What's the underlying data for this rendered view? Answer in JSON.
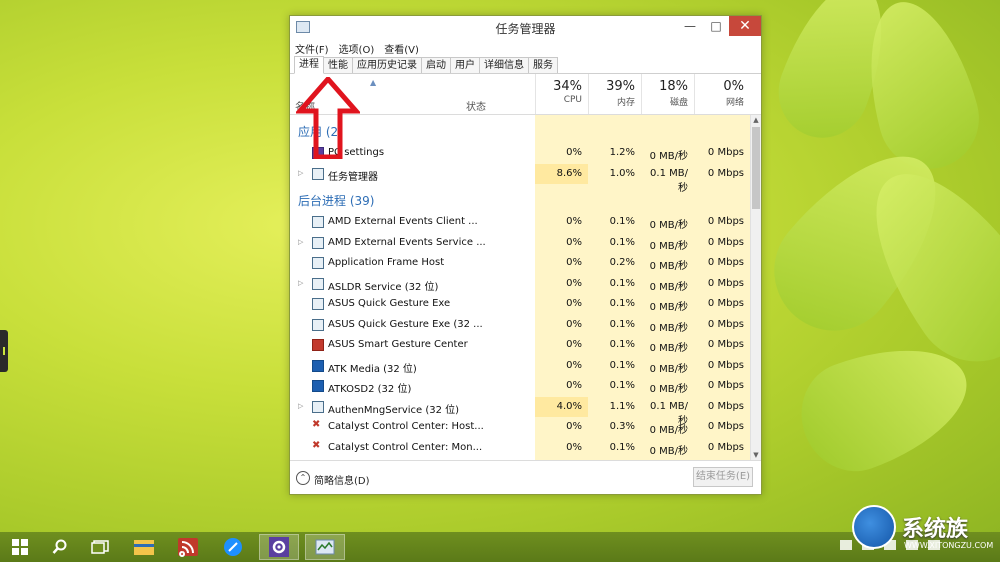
{
  "window": {
    "title": "任务管理器",
    "controls": {
      "minimize": "—",
      "maximize": "□",
      "close": "✕"
    }
  },
  "menu": [
    "文件(F)",
    "选项(O)",
    "查看(V)"
  ],
  "tabs": [
    "进程",
    "性能",
    "应用历史记录",
    "启动",
    "用户",
    "详细信息",
    "服务"
  ],
  "columns": {
    "name": "名称",
    "status": "状态",
    "cpu": {
      "pct": "34%",
      "label": "CPU"
    },
    "memory": {
      "pct": "39%",
      "label": "内存"
    },
    "disk": {
      "pct": "18%",
      "label": "磁盘"
    },
    "network": {
      "pct": "0%",
      "label": "网络"
    }
  },
  "groups": {
    "apps": "应用 (2)",
    "background": "后台进程 (39)"
  },
  "apps": [
    {
      "name": "PC settings",
      "cpu": "0%",
      "mem": "1.2%",
      "disk": "0 MB/秒",
      "net": "0 Mbps",
      "icon": "settings-icon"
    },
    {
      "name": "任务管理器",
      "cpu": "8.6%",
      "mem": "1.0%",
      "disk": "0.1 MB/秒",
      "net": "0 Mbps",
      "icon": "task-manager-icon"
    }
  ],
  "background": [
    {
      "name": "AMD External Events Client ...",
      "cpu": "0%",
      "mem": "0.1%",
      "disk": "0 MB/秒",
      "net": "0 Mbps",
      "icon": "service-icon"
    },
    {
      "name": "AMD External Events Service ...",
      "cpu": "0%",
      "mem": "0.1%",
      "disk": "0 MB/秒",
      "net": "0 Mbps",
      "icon": "service-icon"
    },
    {
      "name": "Application Frame Host",
      "cpu": "0%",
      "mem": "0.2%",
      "disk": "0 MB/秒",
      "net": "0 Mbps",
      "icon": "service-icon"
    },
    {
      "name": "ASLDR Service (32 位)",
      "cpu": "0%",
      "mem": "0.1%",
      "disk": "0 MB/秒",
      "net": "0 Mbps",
      "icon": "window-icon"
    },
    {
      "name": "ASUS Quick Gesture Exe",
      "cpu": "0%",
      "mem": "0.1%",
      "disk": "0 MB/秒",
      "net": "0 Mbps",
      "icon": "service-icon"
    },
    {
      "name": "ASUS Quick Gesture Exe (32 ...",
      "cpu": "0%",
      "mem": "0.1%",
      "disk": "0 MB/秒",
      "net": "0 Mbps",
      "icon": "service-icon"
    },
    {
      "name": "ASUS Smart Gesture Center",
      "cpu": "0%",
      "mem": "0.1%",
      "disk": "0 MB/秒",
      "net": "0 Mbps",
      "icon": "gesture-icon"
    },
    {
      "name": "ATK Media (32 位)",
      "cpu": "0%",
      "mem": "0.1%",
      "disk": "0 MB/秒",
      "net": "0 Mbps",
      "icon": "atk-icon"
    },
    {
      "name": "ATKOSD2 (32 位)",
      "cpu": "0%",
      "mem": "0.1%",
      "disk": "0 MB/秒",
      "net": "0 Mbps",
      "icon": "atk-icon"
    },
    {
      "name": "AuthenMngService (32 位)",
      "cpu": "4.0%",
      "mem": "1.1%",
      "disk": "0.1 MB/秒",
      "net": "0 Mbps",
      "icon": "service-icon"
    },
    {
      "name": "Catalyst Control Center: Host...",
      "cpu": "0%",
      "mem": "0.3%",
      "disk": "0 MB/秒",
      "net": "0 Mbps",
      "icon": "catalyst-icon"
    },
    {
      "name": "Catalyst Control Center: Mon...",
      "cpu": "0%",
      "mem": "0.1%",
      "disk": "0 MB/秒",
      "net": "0 Mbps",
      "icon": "catalyst-icon"
    }
  ],
  "footer": {
    "fewer_details": "简略信息(D)",
    "end_task": "结束任务(E)"
  },
  "taskbar": [
    "start-icon",
    "search-icon",
    "task-view-icon",
    "file-explorer-icon",
    "rss-icon",
    "browser-icon",
    "settings-icon",
    "task-manager-icon"
  ],
  "watermark": {
    "brand": "系统族",
    "url": "WWW.XITONGZU.COM"
  },
  "colors": {
    "accent_blue": "#2d6db5",
    "cpu_highlight": "#fff5c8",
    "close_red": "#c7483b",
    "arrow_red": "#e0141e"
  }
}
